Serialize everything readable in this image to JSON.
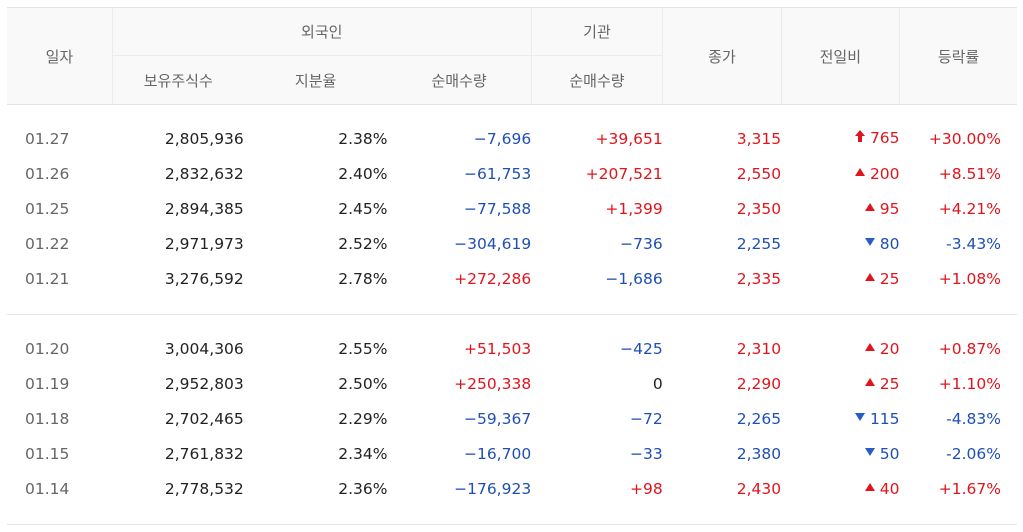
{
  "header": {
    "date": "일자",
    "foreign": "외국인",
    "institution": "기관",
    "close": "종가",
    "change": "전일비",
    "rate": "등락률",
    "holdings": "보유주식수",
    "ownership": "지분율",
    "foreign_net": "순매수량",
    "inst_net": "순매수량"
  },
  "colors": {
    "up": "#e0141c",
    "down": "#1f4fb3"
  },
  "rows": [
    {
      "date": "01.27",
      "holdings": "2,805,936",
      "ownership": "2.38%",
      "foreign_net": "−7,696",
      "fn_dir": "down",
      "inst_net": "+39,651",
      "in_dir": "up",
      "close": "3,315",
      "close_dir": "up",
      "change": "765",
      "change_icon": "limit-up-arrow-icon",
      "change_dir": "up",
      "rate": "+30.00%",
      "rate_dir": "up"
    },
    {
      "date": "01.26",
      "holdings": "2,832,632",
      "ownership": "2.40%",
      "foreign_net": "−61,753",
      "fn_dir": "down",
      "inst_net": "+207,521",
      "in_dir": "up",
      "close": "2,550",
      "close_dir": "up",
      "change": "200",
      "change_icon": "triangle-up-icon",
      "change_dir": "up",
      "rate": "+8.51%",
      "rate_dir": "up"
    },
    {
      "date": "01.25",
      "holdings": "2,894,385",
      "ownership": "2.45%",
      "foreign_net": "−77,588",
      "fn_dir": "down",
      "inst_net": "+1,399",
      "in_dir": "up",
      "close": "2,350",
      "close_dir": "up",
      "change": "95",
      "change_icon": "triangle-up-icon",
      "change_dir": "up",
      "rate": "+4.21%",
      "rate_dir": "up"
    },
    {
      "date": "01.22",
      "holdings": "2,971,973",
      "ownership": "2.52%",
      "foreign_net": "−304,619",
      "fn_dir": "down",
      "inst_net": "−736",
      "in_dir": "down",
      "close": "2,255",
      "close_dir": "down",
      "change": "80",
      "change_icon": "triangle-down-icon",
      "change_dir": "down",
      "rate": "-3.43%",
      "rate_dir": "down"
    },
    {
      "date": "01.21",
      "holdings": "3,276,592",
      "ownership": "2.78%",
      "foreign_net": "+272,286",
      "fn_dir": "up",
      "inst_net": "−1,686",
      "in_dir": "down",
      "close": "2,335",
      "close_dir": "up",
      "change": "25",
      "change_icon": "triangle-up-icon",
      "change_dir": "up",
      "rate": "+1.08%",
      "rate_dir": "up"
    },
    {
      "date": "01.20",
      "holdings": "3,004,306",
      "ownership": "2.55%",
      "foreign_net": "+51,503",
      "fn_dir": "up",
      "inst_net": "−425",
      "in_dir": "down",
      "close": "2,310",
      "close_dir": "up",
      "change": "20",
      "change_icon": "triangle-up-icon",
      "change_dir": "up",
      "rate": "+0.87%",
      "rate_dir": "up"
    },
    {
      "date": "01.19",
      "holdings": "2,952,803",
      "ownership": "2.50%",
      "foreign_net": "+250,338",
      "fn_dir": "up",
      "inst_net": "0",
      "in_dir": "none",
      "close": "2,290",
      "close_dir": "up",
      "change": "25",
      "change_icon": "triangle-up-icon",
      "change_dir": "up",
      "rate": "+1.10%",
      "rate_dir": "up"
    },
    {
      "date": "01.18",
      "holdings": "2,702,465",
      "ownership": "2.29%",
      "foreign_net": "−59,367",
      "fn_dir": "down",
      "inst_net": "−72",
      "in_dir": "down",
      "close": "2,265",
      "close_dir": "down",
      "change": "115",
      "change_icon": "triangle-down-icon",
      "change_dir": "down",
      "rate": "-4.83%",
      "rate_dir": "down"
    },
    {
      "date": "01.15",
      "holdings": "2,761,832",
      "ownership": "2.34%",
      "foreign_net": "−16,700",
      "fn_dir": "down",
      "inst_net": "−33",
      "in_dir": "down",
      "close": "2,380",
      "close_dir": "down",
      "change": "50",
      "change_icon": "triangle-down-icon",
      "change_dir": "down",
      "rate": "-2.06%",
      "rate_dir": "down"
    },
    {
      "date": "01.14",
      "holdings": "2,778,532",
      "ownership": "2.36%",
      "foreign_net": "−176,923",
      "fn_dir": "down",
      "inst_net": "+98",
      "in_dir": "up",
      "close": "2,430",
      "close_dir": "up",
      "change": "40",
      "change_icon": "triangle-up-icon",
      "change_dir": "up",
      "rate": "+1.67%",
      "rate_dir": "up"
    }
  ]
}
